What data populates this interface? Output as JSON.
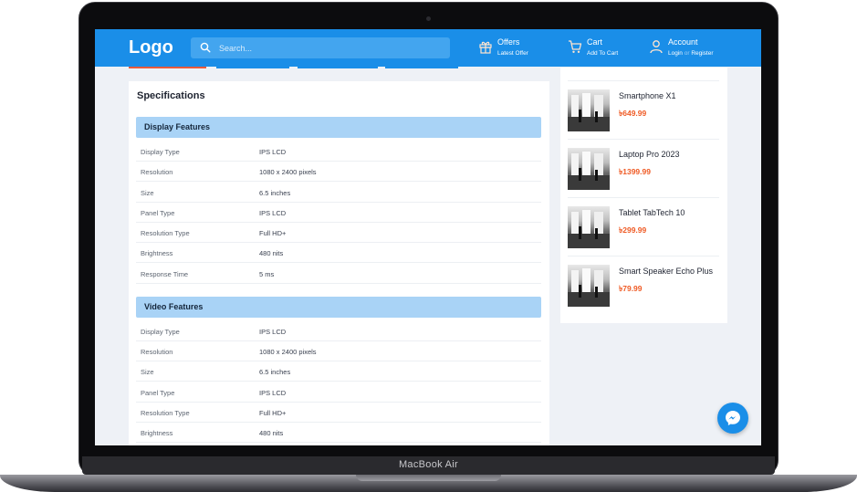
{
  "device": {
    "model_label": "MacBook Air"
  },
  "header": {
    "logo": "Logo",
    "search_placeholder": "Search...",
    "offers": {
      "title": "Offers",
      "subtitle": "Latest Offer"
    },
    "cart": {
      "title": "Cart",
      "subtitle": "Add To Cart"
    },
    "account": {
      "title": "Account",
      "login": "Login",
      "separator": "or",
      "register": "Register"
    }
  },
  "specifications": {
    "title": "Specifications",
    "groups": [
      {
        "name": "Display Features",
        "rows": [
          {
            "key": "Display Type",
            "value": "IPS LCD"
          },
          {
            "key": "Resolution",
            "value": "1080 x 2400 pixels"
          },
          {
            "key": "Size",
            "value": "6.5 inches"
          },
          {
            "key": "Panel Type",
            "value": "IPS LCD"
          },
          {
            "key": "Resolution Type",
            "value": "Full HD+"
          },
          {
            "key": "Brightness",
            "value": "480 nits"
          },
          {
            "key": "Response Time",
            "value": "5 ms"
          }
        ]
      },
      {
        "name": "Video Features",
        "rows": [
          {
            "key": "Display Type",
            "value": "IPS LCD"
          },
          {
            "key": "Resolution",
            "value": "1080 x 2400 pixels"
          },
          {
            "key": "Size",
            "value": "6.5 inches"
          },
          {
            "key": "Panel Type",
            "value": "IPS LCD"
          },
          {
            "key": "Resolution Type",
            "value": "Full HD+"
          },
          {
            "key": "Brightness",
            "value": "480 nits"
          }
        ]
      }
    ]
  },
  "related_products": {
    "items": [
      {
        "name": "Smartphone X1",
        "price": "৳649.99"
      },
      {
        "name": "Laptop Pro 2023",
        "price": "৳1399.99"
      },
      {
        "name": "Tablet TabTech 10",
        "price": "৳299.99"
      },
      {
        "name": "Smart Speaker Echo Plus",
        "price": "৳79.99"
      }
    ]
  },
  "colors": {
    "header_bg": "#1a8ee8",
    "group_header_bg": "#a9d3f6",
    "price": "#ef5a24",
    "page_bg": "#eef1f6"
  },
  "icons": {
    "search": "search-icon",
    "offers": "gift-icon",
    "cart": "cart-icon",
    "account": "user-icon",
    "chat": "messenger-icon"
  }
}
